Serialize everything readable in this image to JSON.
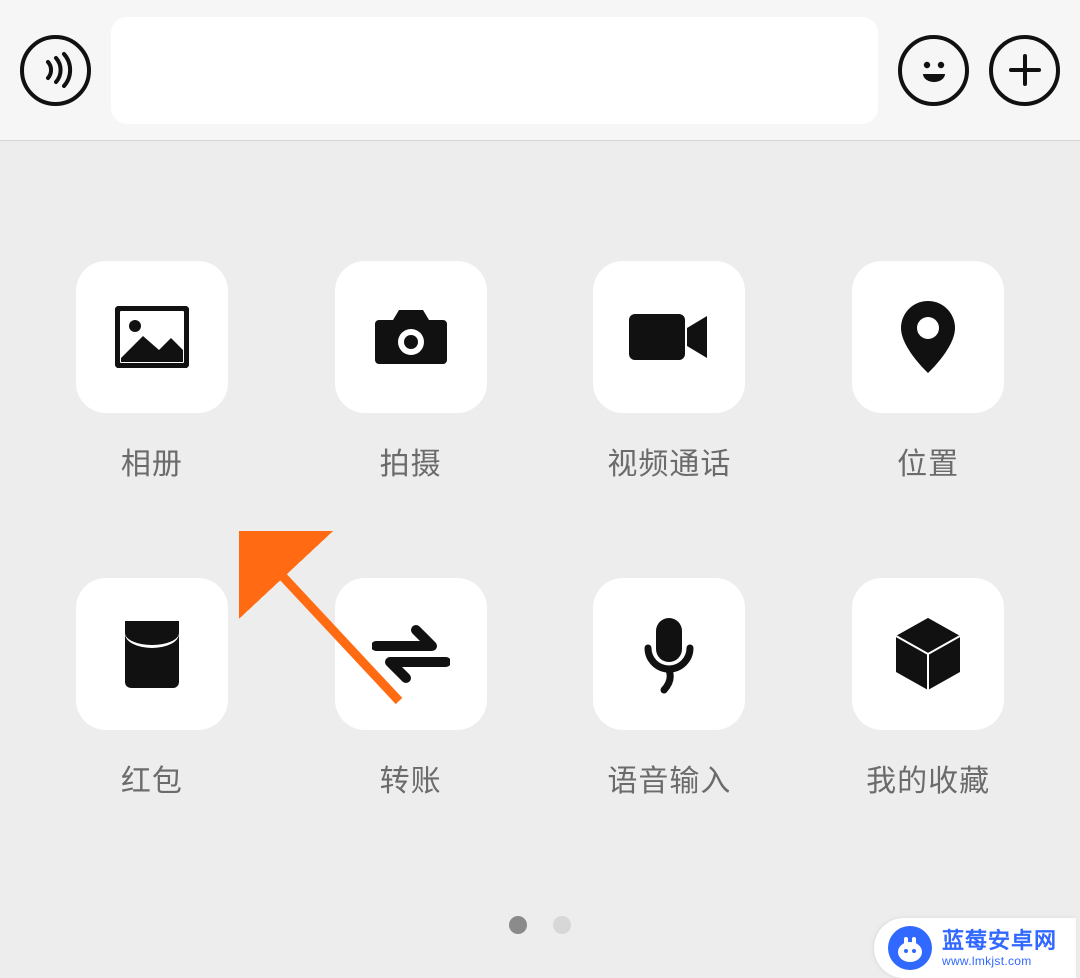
{
  "input_bar": {
    "voice_button": "voice-icon",
    "emoji_button": "emoji-icon",
    "plus_button": "plus-icon",
    "text_value": "",
    "text_placeholder": ""
  },
  "panel": {
    "items": [
      {
        "name": "album",
        "label": "相册",
        "icon": "image-icon"
      },
      {
        "name": "shoot",
        "label": "拍摄",
        "icon": "camera-icon"
      },
      {
        "name": "videocall",
        "label": "视频通话",
        "icon": "video-icon"
      },
      {
        "name": "location",
        "label": "位置",
        "icon": "location-icon"
      },
      {
        "name": "redpacket",
        "label": "红包",
        "icon": "envelope-icon"
      },
      {
        "name": "transfer",
        "label": "转账",
        "icon": "transfer-icon"
      },
      {
        "name": "voicein",
        "label": "语音输入",
        "icon": "mic-icon"
      },
      {
        "name": "favorites",
        "label": "我的收藏",
        "icon": "cube-icon"
      }
    ]
  },
  "pager": {
    "pages": 2,
    "active_index": 0
  },
  "annotation": {
    "arrow_color": "#ff6a13"
  },
  "watermark": {
    "title": "蓝莓安卓网",
    "url": "www.lmkjst.com"
  }
}
